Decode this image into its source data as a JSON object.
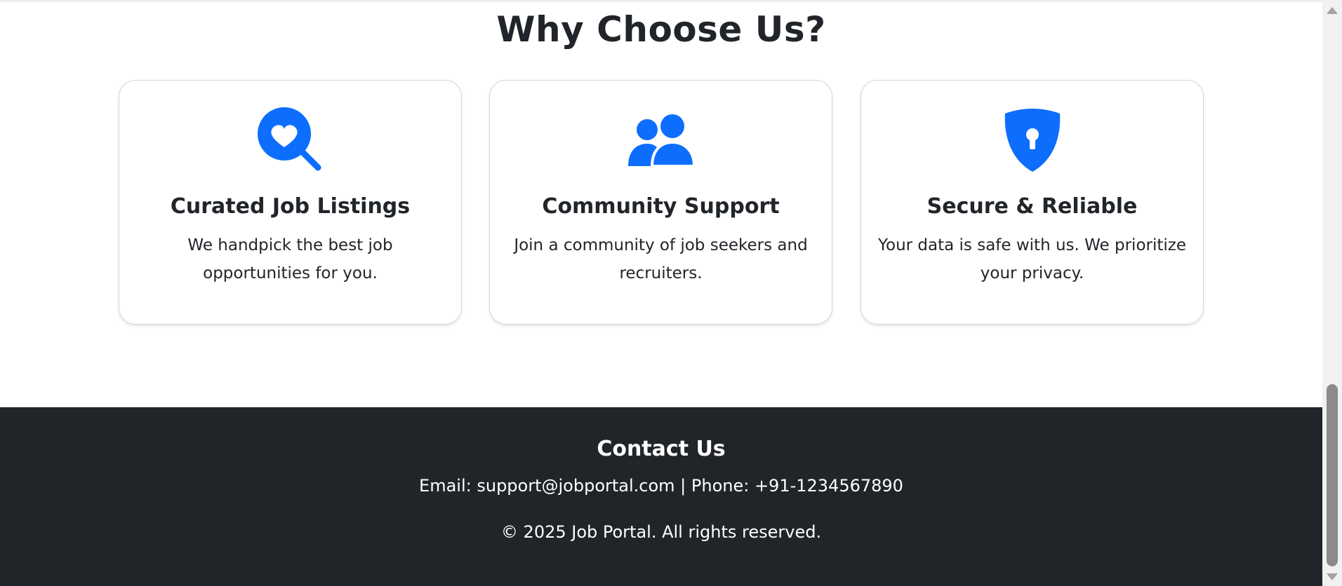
{
  "why_section": {
    "title": "Why Choose Us?",
    "accent_color": "#0d6efd",
    "cards": [
      {
        "icon": "search-heart-icon",
        "title": "Curated Job Listings",
        "text": "We handpick the best job opportunities for you."
      },
      {
        "icon": "people-icon",
        "title": "Community Support",
        "text": "Join a community of job seekers and recruiters."
      },
      {
        "icon": "shield-lock-icon",
        "title": "Secure & Reliable",
        "text": "Your data is safe with us. We prioritize your privacy."
      }
    ]
  },
  "footer": {
    "title": "Contact Us",
    "contact_line": "Email: support@jobportal.com | Phone: +91-1234567890",
    "copyright": "© 2025 Job Portal. All rights reserved.",
    "background_color": "#212529"
  },
  "scrollbar": {
    "up_icon": "scroll-up-arrow-icon",
    "down_icon": "scroll-down-arrow-icon"
  }
}
